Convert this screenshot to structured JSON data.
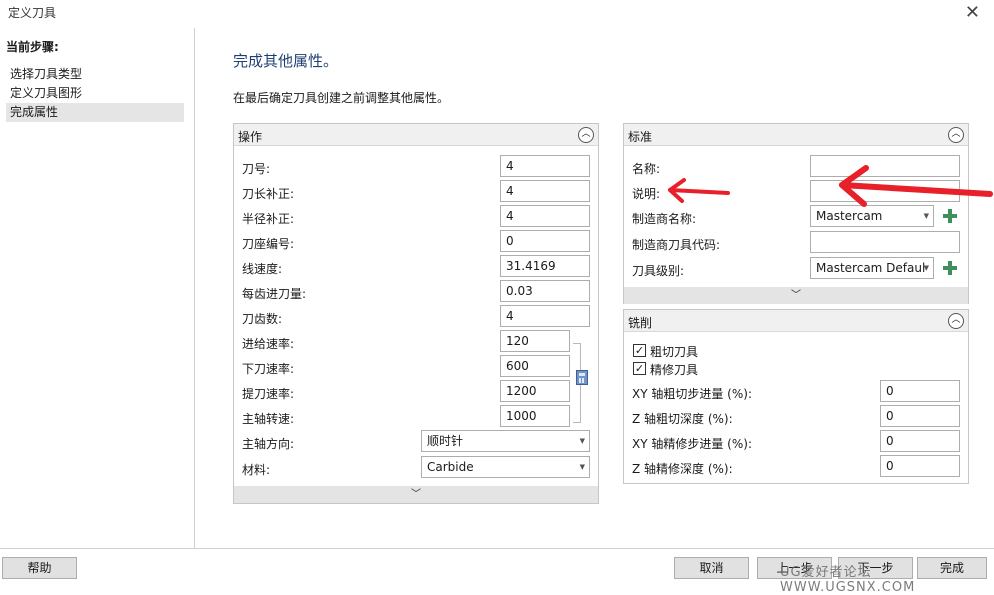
{
  "window": {
    "title": "定义刀具"
  },
  "steps": {
    "heading": "当前步骤:",
    "items": [
      "选择刀具类型",
      "定义刀具图形",
      "完成属性"
    ]
  },
  "main": {
    "title": "完成其他属性。",
    "description": "在最后确定刀具创建之前调整其他属性。"
  },
  "operation": {
    "title": "操作",
    "fields": [
      {
        "label": "刀号:",
        "value": "4"
      },
      {
        "label": "刀长补正:",
        "value": "4"
      },
      {
        "label": "半径补正:",
        "value": "4"
      },
      {
        "label": "刀座编号:",
        "value": "0"
      },
      {
        "label": "线速度:",
        "value": "31.4169"
      },
      {
        "label": "每齿进刀量:",
        "value": "0.03"
      },
      {
        "label": "刀齿数:",
        "value": "4"
      },
      {
        "label": "进给速率:",
        "value": "120"
      },
      {
        "label": "下刀速率:",
        "value": "600"
      },
      {
        "label": "提刀速率:",
        "value": "1200"
      },
      {
        "label": "主轴转速:",
        "value": "1000"
      }
    ],
    "spindle_label": "主轴方向:",
    "spindle_value": "顺时针",
    "material_label": "材料:",
    "material_value": "Carbide"
  },
  "standard": {
    "title": "标准",
    "name_label": "名称:",
    "name_value": "",
    "desc_label": "说明:",
    "desc_value": "",
    "mfr_label": "制造商名称:",
    "mfr_value": "Mastercam",
    "mfr_code_label": "制造商刀具代码:",
    "mfr_code_value": "",
    "level_label": "刀具级别:",
    "level_value": "Mastercam Defaul"
  },
  "milling": {
    "title": "铣削",
    "rough_label": "粗切刀具",
    "rough_checked": true,
    "finish_label": "精修刀具",
    "finish_checked": true,
    "fields": [
      {
        "label": "XY 轴粗切步进量 (%):",
        "value": "0"
      },
      {
        "label": "Z 轴粗切深度 (%):",
        "value": "0"
      },
      {
        "label": "XY 轴精修步进量 (%):",
        "value": "0"
      },
      {
        "label": "Z 轴精修深度 (%):",
        "value": "0"
      }
    ]
  },
  "buttons": {
    "help": "帮助",
    "cancel": "取消",
    "back": "上一步",
    "next": "下一步",
    "finish": "完成"
  },
  "watermark": "UG爱好者论坛  WWW.UGSNX.COM",
  "colors": {
    "accent_title": "#1e3f72",
    "arrow": "#e8202a",
    "plus": "#3f8f5c"
  }
}
